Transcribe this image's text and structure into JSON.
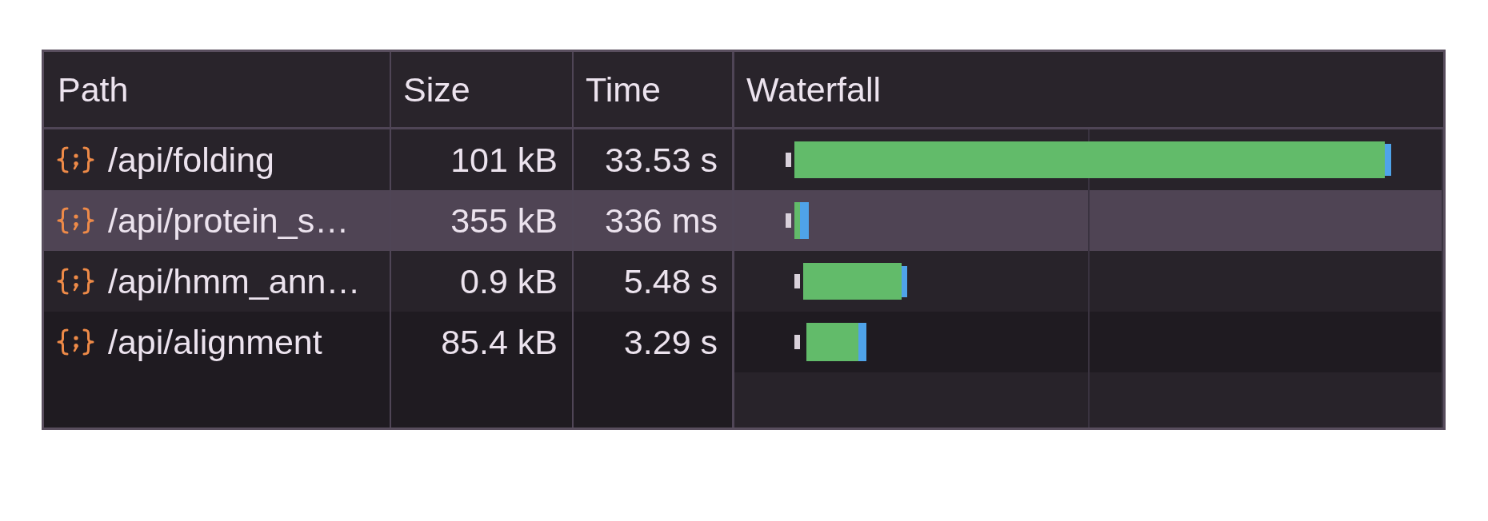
{
  "table": {
    "columns": [
      "Path",
      "Size",
      "Time",
      "Waterfall"
    ],
    "rows": [
      {
        "path": "/api/folding",
        "size": "101 kB",
        "time": "33.53 s",
        "selected": false
      },
      {
        "path": "/api/protein_s…",
        "size": "355 kB",
        "time": "336 ms",
        "selected": true
      },
      {
        "path": "/api/hmm_ann…",
        "size": "0.9 kB",
        "time": "5.48 s",
        "selected": false
      },
      {
        "path": "/api/alignment",
        "size": "85.4 kB",
        "time": "3.29 s",
        "selected": false
      }
    ]
  }
}
